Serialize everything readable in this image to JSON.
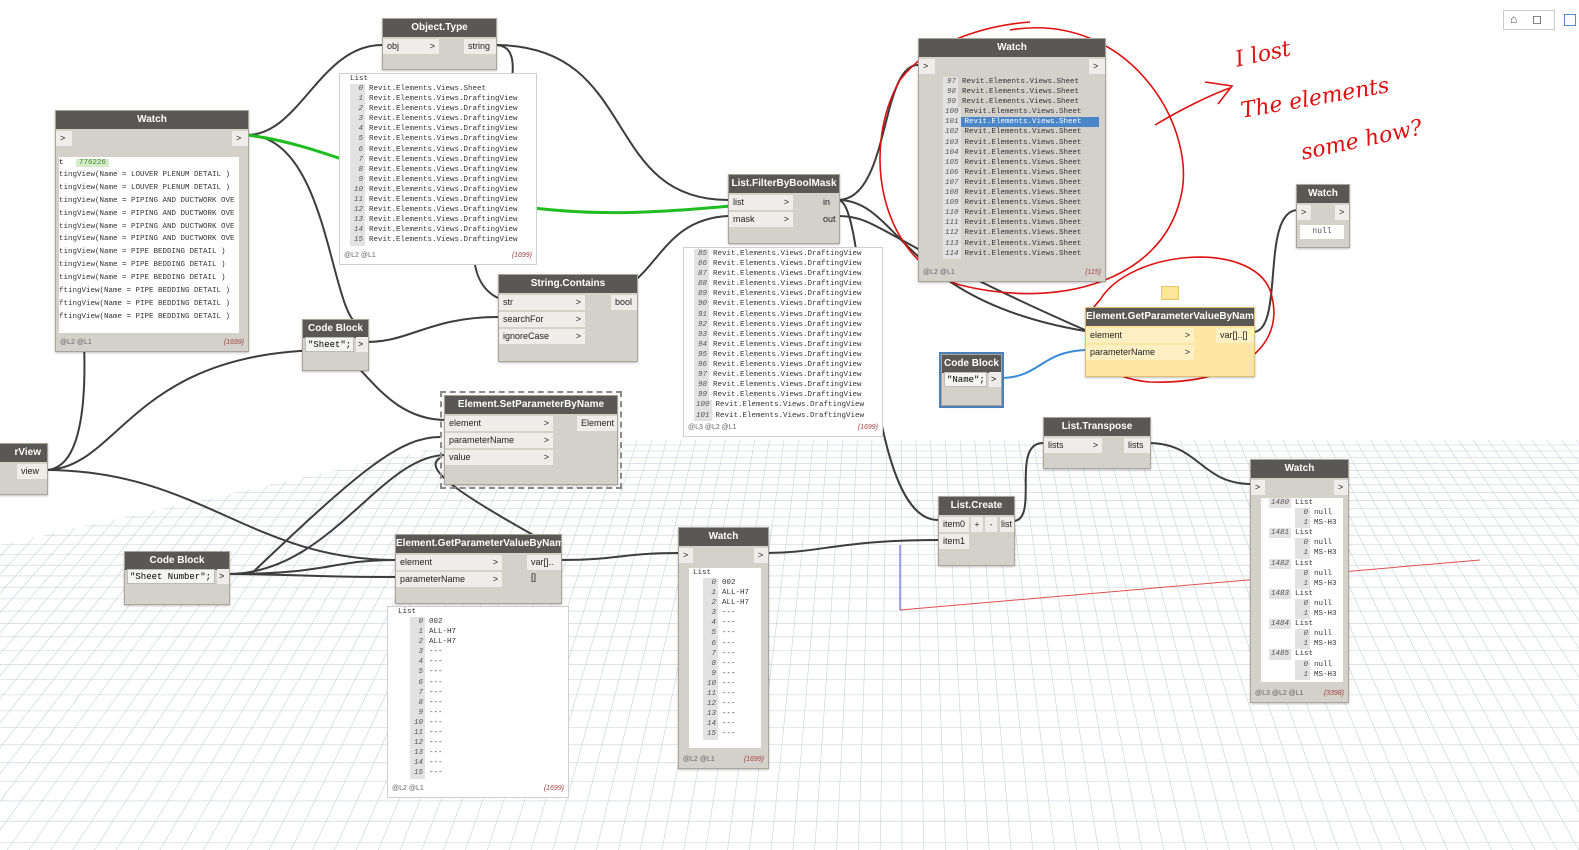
{
  "toolbar": {
    "view_icons": "⌂◻"
  },
  "nodes": {
    "watch_left": {
      "title": "Watch",
      "in": ">",
      "out": ">",
      "count_badge": "776226",
      "lines": [
        "tingView(Name = LOUVER PLENUM DETAIL )",
        "tingView(Name = LOUVER PLENUM DETAIL )",
        "tingView(Name = PIPING AND DUCTWORK OVE",
        "tingView(Name = PIPING AND DUCTWORK OVE",
        "tingView(Name = PIPING AND DUCTWORK OVE",
        "tingView(Name = PIPING AND DUCTWORK OVE",
        "tingView(Name = PIPE BEDDING DETAIL )",
        "tingView(Name = PIPE BEDDING DETAIL )",
        "tingView(Name = PIPE BEDDING DETAIL )",
        "ftingView(Name = PIPE BEDDING DETAIL )",
        "ftingView(Name = PIPE BEDDING DETAIL )",
        "ftingView(Name = PIPE BEDDING DETAIL )"
      ],
      "levels": "@L2 @L1",
      "count": "{1699}",
      "prefix": "t"
    },
    "object_type": {
      "title": "Object.Type",
      "in": "obj",
      "out": "string"
    },
    "object_type_preview": {
      "header": "List",
      "rows": [
        [
          "0",
          "Revit.Elements.Views.Sheet"
        ],
        [
          "1",
          "Revit.Elements.Views.DraftingView"
        ],
        [
          "2",
          "Revit.Elements.Views.DraftingView"
        ],
        [
          "3",
          "Revit.Elements.Views.DraftingView"
        ],
        [
          "4",
          "Revit.Elements.Views.DraftingView"
        ],
        [
          "5",
          "Revit.Elements.Views.DraftingView"
        ],
        [
          "6",
          "Revit.Elements.Views.DraftingView"
        ],
        [
          "7",
          "Revit.Elements.Views.DraftingView"
        ],
        [
          "8",
          "Revit.Elements.Views.DraftingView"
        ],
        [
          "9",
          "Revit.Elements.Views.DraftingView"
        ],
        [
          "10",
          "Revit.Elements.Views.DraftingView"
        ],
        [
          "11",
          "Revit.Elements.Views.DraftingView"
        ],
        [
          "12",
          "Revit.Elements.Views.DraftingView"
        ],
        [
          "13",
          "Revit.Elements.Views.DraftingView"
        ],
        [
          "14",
          "Revit.Elements.Views.DraftingView"
        ],
        [
          "15",
          "Revit.Elements.Views.DraftingView"
        ]
      ],
      "levels": "@L2 @L1",
      "count": "{1699}"
    },
    "filter_bool": {
      "title": "List.FilterByBoolMask",
      "in1": "list",
      "in2": "mask",
      "out1": "in",
      "out2": "out"
    },
    "filter_preview": {
      "rows": [
        [
          "85",
          "Revit.Elements.Views.DraftingView"
        ],
        [
          "86",
          "Revit.Elements.Views.DraftingView"
        ],
        [
          "87",
          "Revit.Elements.Views.DraftingView"
        ],
        [
          "88",
          "Revit.Elements.Views.DraftingView"
        ],
        [
          "89",
          "Revit.Elements.Views.DraftingView"
        ],
        [
          "90",
          "Revit.Elements.Views.DraftingView"
        ],
        [
          "91",
          "Revit.Elements.Views.DraftingView"
        ],
        [
          "92",
          "Revit.Elements.Views.DraftingView"
        ],
        [
          "93",
          "Revit.Elements.Views.DraftingView"
        ],
        [
          "94",
          "Revit.Elements.Views.DraftingView"
        ],
        [
          "95",
          "Revit.Elements.Views.DraftingView"
        ],
        [
          "96",
          "Revit.Elements.Views.DraftingView"
        ],
        [
          "97",
          "Revit.Elements.Views.DraftingView"
        ],
        [
          "98",
          "Revit.Elements.Views.DraftingView"
        ],
        [
          "99",
          "Revit.Elements.Views.DraftingView"
        ],
        [
          "100",
          "Revit.Elements.Views.DraftingView"
        ],
        [
          "101",
          "Revit.Elements.Views.DraftingView"
        ]
      ],
      "levels": "@L3 @L2 @L1",
      "count": "{1699}"
    },
    "watch_top_right": {
      "title": "Watch",
      "in": ">",
      "out": ">",
      "rows": [
        [
          "97",
          "Revit.Elements.Views.Sheet"
        ],
        [
          "98",
          "Revit.Elements.Views.Sheet"
        ],
        [
          "99",
          "Revit.Elements.Views.Sheet"
        ],
        [
          "100",
          "Revit.Elements.Views.Sheet"
        ],
        [
          "101",
          "Revit.Elements.Views.Sheet"
        ],
        [
          "102",
          "Revit.Elements.Views.Sheet"
        ],
        [
          "103",
          "Revit.Elements.Views.Sheet"
        ],
        [
          "104",
          "Revit.Elements.Views.Sheet"
        ],
        [
          "105",
          "Revit.Elements.Views.Sheet"
        ],
        [
          "106",
          "Revit.Elements.Views.Sheet"
        ],
        [
          "107",
          "Revit.Elements.Views.Sheet"
        ],
        [
          "108",
          "Revit.Elements.Views.Sheet"
        ],
        [
          "109",
          "Revit.Elements.Views.Sheet"
        ],
        [
          "110",
          "Revit.Elements.Views.Sheet"
        ],
        [
          "111",
          "Revit.Elements.Views.Sheet"
        ],
        [
          "112",
          "Revit.Elements.Views.Sheet"
        ],
        [
          "113",
          "Revit.Elements.Views.Sheet"
        ],
        [
          "114",
          "Revit.Elements.Views.Sheet"
        ]
      ],
      "selected_index": 4,
      "levels": "@L2 @L1",
      "count": "{115}"
    },
    "watch_null": {
      "title": "Watch",
      "in": ">",
      "out": ">",
      "value": "null"
    },
    "string_contains": {
      "title": "String.Contains",
      "in1": "str",
      "in2": "searchFor",
      "in3": "ignoreCase",
      "out": "bool"
    },
    "code_sheet": {
      "title": "Code Block",
      "code": "\"Sheet\";",
      "out": ">"
    },
    "get_param_yellow": {
      "title": "Element.GetParameterValueByName",
      "in1": "element",
      "in2": "parameterName",
      "out": "var[]..[]"
    },
    "code_name": {
      "title": "Code Block",
      "code": "\"Name\";",
      "out": ">"
    },
    "set_param": {
      "title": "Element.SetParameterByName",
      "in1": "element",
      "in2": "parameterName",
      "in3": "value",
      "out": "Element"
    },
    "list_transpose": {
      "title": "List.Transpose",
      "in": "lists",
      "out": "lists"
    },
    "left_view": {
      "title": "rView",
      "out": "view"
    },
    "code_sheet_number": {
      "title": "Code Block",
      "code": "\"Sheet Number\";",
      "out": ">"
    },
    "get_param_bottom": {
      "title": "Element.GetParameterValueByName",
      "in1": "element",
      "in2": "parameterName",
      "out": "var[]..[]"
    },
    "get_param_bottom_preview": {
      "header": "List",
      "rows": [
        [
          "0",
          "002"
        ],
        [
          "1",
          "ALL-H7"
        ],
        [
          "2",
          "ALL-H7"
        ],
        [
          "3",
          "---"
        ],
        [
          "4",
          "---"
        ],
        [
          "5",
          "---"
        ],
        [
          "6",
          "---"
        ],
        [
          "7",
          "---"
        ],
        [
          "8",
          "---"
        ],
        [
          "9",
          "---"
        ],
        [
          "10",
          "---"
        ],
        [
          "11",
          "---"
        ],
        [
          "12",
          "---"
        ],
        [
          "13",
          "---"
        ],
        [
          "14",
          "---"
        ],
        [
          "15",
          "---"
        ]
      ],
      "levels": "@L2 @L1",
      "count": "{1699}"
    },
    "watch_bottom": {
      "title": "Watch",
      "in": ">",
      "out": ">",
      "header": "List",
      "rows": [
        [
          "0",
          "002"
        ],
        [
          "1",
          "ALL-H7"
        ],
        [
          "2",
          "ALL-H7"
        ],
        [
          "3",
          "---"
        ],
        [
          "4",
          "---"
        ],
        [
          "5",
          "---"
        ],
        [
          "6",
          "---"
        ],
        [
          "7",
          "---"
        ],
        [
          "8",
          "---"
        ],
        [
          "9",
          "---"
        ],
        [
          "10",
          "---"
        ],
        [
          "11",
          "---"
        ],
        [
          "12",
          "---"
        ],
        [
          "13",
          "---"
        ],
        [
          "14",
          "---"
        ],
        [
          "15",
          "---"
        ]
      ],
      "levels": "@L2 @L1",
      "count": "{1699}"
    },
    "list_create": {
      "title": "List.Create",
      "in1": "item0",
      "in2": "item1",
      "plus": "+",
      "minus": "-",
      "out": "list"
    },
    "watch_far_right": {
      "title": "Watch",
      "in": ">",
      "out": ">",
      "groups": [
        {
          "label": "1480",
          "tag": "List",
          "items": [
            [
              "0",
              "null"
            ],
            [
              "1",
              "MS-H3"
            ]
          ]
        },
        {
          "label": "1481",
          "tag": "List",
          "items": [
            [
              "0",
              "null"
            ],
            [
              "1",
              "MS-H3"
            ]
          ]
        },
        {
          "label": "1482",
          "tag": "List",
          "items": [
            [
              "0",
              "null"
            ],
            [
              "1",
              "MS-H3"
            ]
          ]
        },
        {
          "label": "1483",
          "tag": "List",
          "items": [
            [
              "0",
              "null"
            ],
            [
              "1",
              "MS-H3"
            ]
          ]
        },
        {
          "label": "1484",
          "tag": "List",
          "items": [
            [
              "0",
              "null"
            ],
            [
              "1",
              "MS-H3"
            ]
          ]
        },
        {
          "label": "1485",
          "tag": "List",
          "items": [
            [
              "0",
              "null"
            ],
            [
              "1",
              "MS-H3"
            ]
          ]
        }
      ],
      "levels": "@L3 @L2 @L1",
      "count": "{3398}"
    }
  },
  "annotation": {
    "line1": "I lost",
    "line2": "The elements",
    "line3": "some how?",
    "color": "#e01010"
  },
  "colors": {
    "wire": "#3d3d3d",
    "highlight_wire": "#1fbd1f",
    "blue_wire": "#3a8ad8",
    "red_annotation": "#e01010",
    "node_header": "#5a5854",
    "selected_row": "#4a86c8"
  }
}
